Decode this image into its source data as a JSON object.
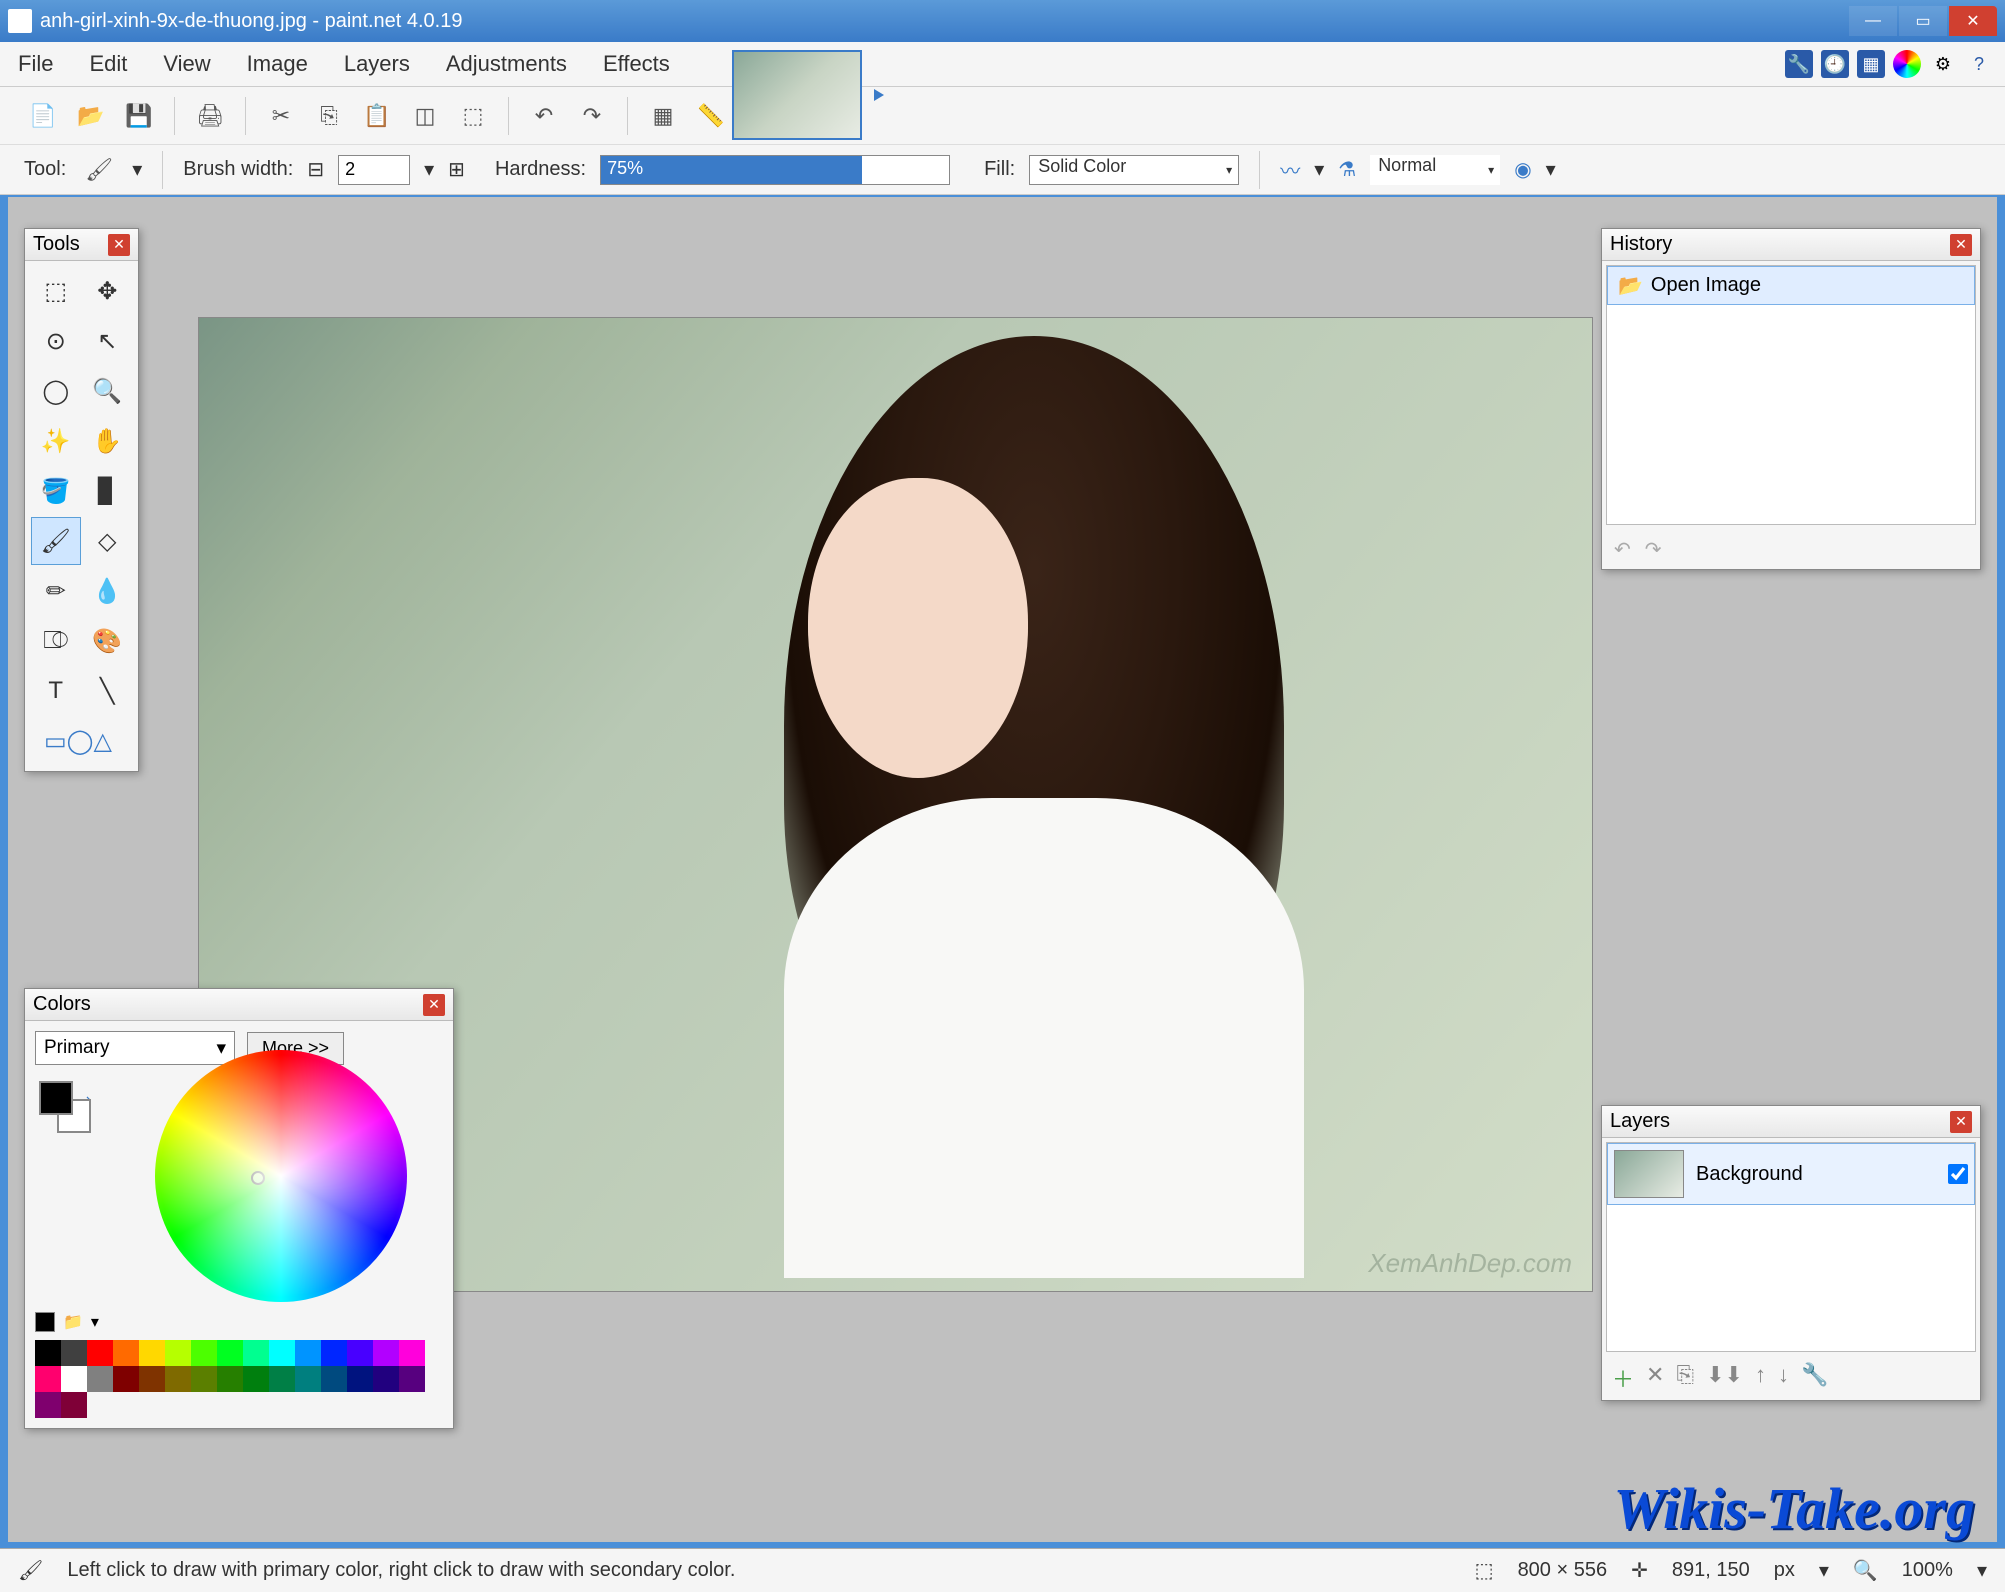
{
  "titlebar": {
    "text": "anh-girl-xinh-9x-de-thuong.jpg - paint.net 4.0.19"
  },
  "menu": {
    "file": "File",
    "edit": "Edit",
    "view": "View",
    "image": "Image",
    "layers": "Layers",
    "adjustments": "Adjustments",
    "effects": "Effects"
  },
  "toolbar2": {
    "tool_label": "Tool:",
    "brush_width_label": "Brush width:",
    "brush_width_value": "2",
    "hardness_label": "Hardness:",
    "hardness_value": "75%",
    "fill_label": "Fill:",
    "fill_value": "Solid Color",
    "blend_value": "Normal"
  },
  "tools_panel": {
    "title": "Tools"
  },
  "history_panel": {
    "title": "History",
    "item": "Open Image"
  },
  "colors_panel": {
    "title": "Colors",
    "primary": "Primary",
    "more": "More >>"
  },
  "layers_panel": {
    "title": "Layers",
    "layer0": "Background"
  },
  "statusbar": {
    "hint": "Left click to draw with primary color, right click to draw with secondary color.",
    "dims": "800 × 556",
    "cursor": "891, 150",
    "unit": "px",
    "zoom": "100%"
  },
  "canvas_watermark": "XemAnhDep.com",
  "site_watermark": "Wikis-Take.org"
}
